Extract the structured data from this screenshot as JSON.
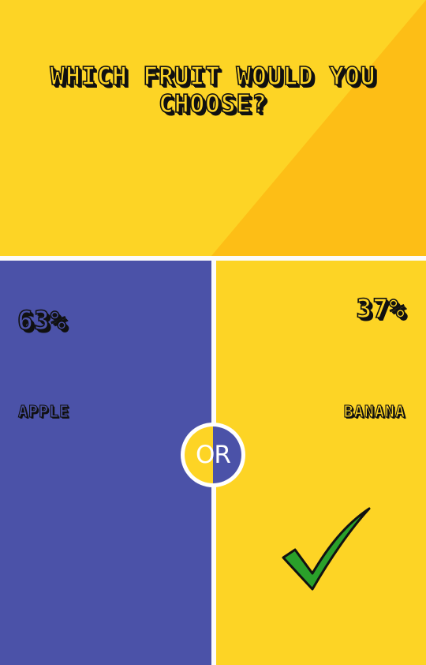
{
  "question": "WHICH FRUIT WOULD YOU CHOOSE?",
  "options": [
    {
      "label": "APPLE",
      "percent": "63%",
      "percent_value": 63,
      "color": "#4b52a8"
    },
    {
      "label": "BANANA",
      "percent": "37%",
      "percent_value": 37,
      "color": "#fdd425",
      "selected": true
    }
  ],
  "separator": "OR",
  "icons": {
    "selection": "checkmark-icon"
  },
  "colors": {
    "top_background": "#fdd425",
    "top_diagonal": "#fdbe16",
    "divider": "#fcfcfc",
    "check_fill": "#2aa02a",
    "outline": "#111111"
  }
}
